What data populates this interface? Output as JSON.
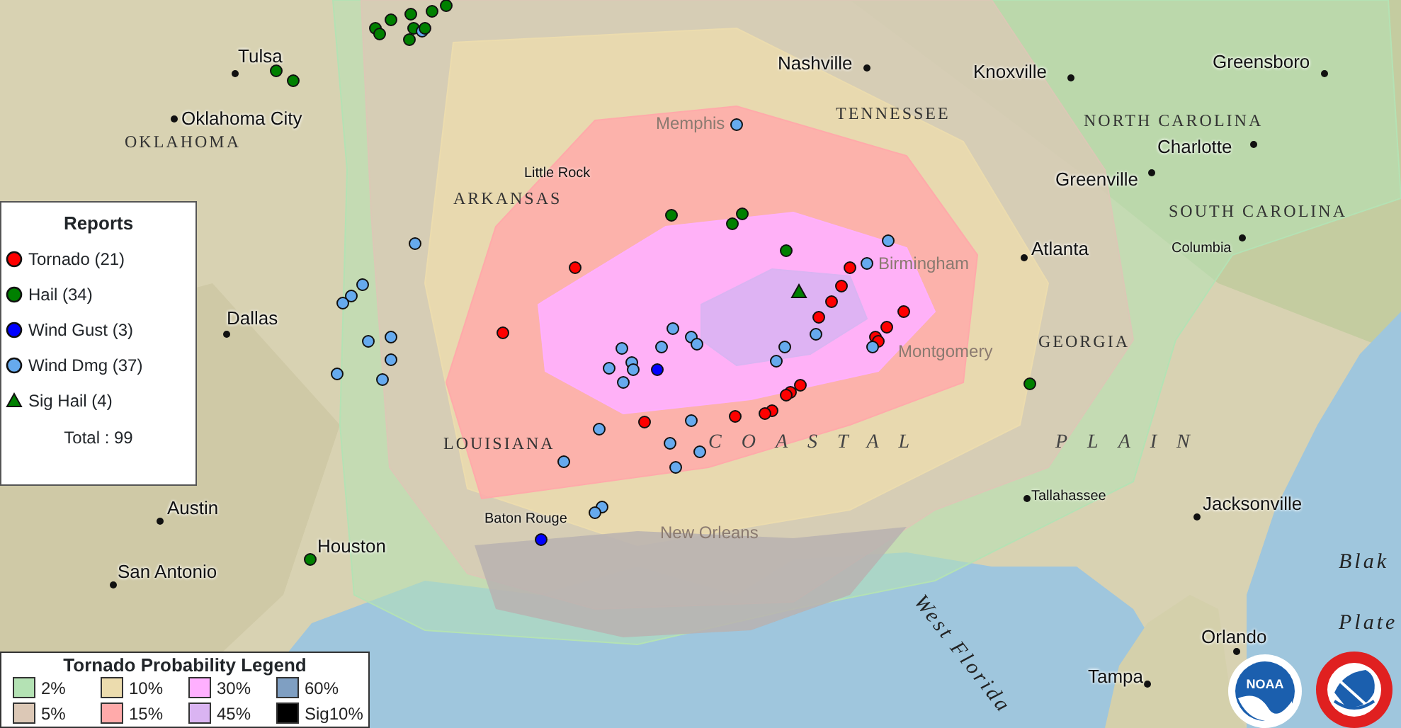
{
  "map": {
    "labels": [
      {
        "text": "Tulsa",
        "kind": "city"
      },
      {
        "text": "Oklahoma City",
        "kind": "city"
      },
      {
        "text": "OKLAHOMA",
        "kind": "state"
      },
      {
        "text": "Dallas",
        "kind": "city"
      },
      {
        "text": "Austin",
        "kind": "city"
      },
      {
        "text": "San Antonio",
        "kind": "city"
      },
      {
        "text": "Houston",
        "kind": "city"
      },
      {
        "text": "Baton Rouge",
        "kind": "minor"
      },
      {
        "text": "New Orleans",
        "kind": "faint"
      },
      {
        "text": "Memphis",
        "kind": "faint"
      },
      {
        "text": "Little Rock",
        "kind": "minor"
      },
      {
        "text": "ARKANSAS",
        "kind": "state"
      },
      {
        "text": "LOUISIANA",
        "kind": "state"
      },
      {
        "text": "Nashville",
        "kind": "city"
      },
      {
        "text": "TENNESSEE",
        "kind": "state"
      },
      {
        "text": "Knoxville",
        "kind": "city"
      },
      {
        "text": "Greensboro",
        "kind": "city"
      },
      {
        "text": "NORTH CAROLINA",
        "kind": "state"
      },
      {
        "text": "Charlotte",
        "kind": "city"
      },
      {
        "text": "Greenville",
        "kind": "city"
      },
      {
        "text": "SOUTH CAROLINA",
        "kind": "state"
      },
      {
        "text": "Columbia",
        "kind": "minor"
      },
      {
        "text": "Atlanta",
        "kind": "city"
      },
      {
        "text": "Birmingham",
        "kind": "faint"
      },
      {
        "text": "Montgomery",
        "kind": "faint"
      },
      {
        "text": "GEORGIA",
        "kind": "state"
      },
      {
        "text": "COASTAL",
        "kind": "region"
      },
      {
        "text": "PLAIN",
        "kind": "region"
      },
      {
        "text": "Tallahassee",
        "kind": "minor"
      },
      {
        "text": "Jacksonville",
        "kind": "city"
      },
      {
        "text": "Orlando",
        "kind": "city"
      },
      {
        "text": "Tampa",
        "kind": "city"
      },
      {
        "text": "Blak",
        "kind": "sea"
      },
      {
        "text": "Plate",
        "kind": "sea"
      },
      {
        "text": "West Florida",
        "kind": "sea"
      }
    ]
  },
  "reports_legend": {
    "title": "Reports",
    "items": [
      {
        "label": "Tornado (21)",
        "kind": "dot",
        "color": "#ff0000"
      },
      {
        "label": "Hail (34)",
        "kind": "dot",
        "color": "#008000"
      },
      {
        "label": "Wind Gust (3)",
        "kind": "dot",
        "color": "#0000ff"
      },
      {
        "label": "Wind Dmg (37)",
        "kind": "dot",
        "color": "#66aaee"
      },
      {
        "label": "Sig Hail (4)",
        "kind": "triangle",
        "color": "#008000"
      }
    ],
    "total": "Total : 99"
  },
  "tornado_legend": {
    "title": "Tornado Probability Legend",
    "items": [
      {
        "label": "2%",
        "color": "#b4e2b4"
      },
      {
        "label": "10%",
        "color": "#ecdcae"
      },
      {
        "label": "30%",
        "color": "#ffb0ff"
      },
      {
        "label": "60%",
        "color": "#7f9fc2"
      },
      {
        "label": "5%",
        "color": "#dcc8b6"
      },
      {
        "label": "15%",
        "color": "#ffaaaa"
      },
      {
        "label": "45%",
        "color": "#dab4f2"
      },
      {
        "label": "Sig10%",
        "color": "#000000"
      }
    ]
  },
  "logos": {
    "noaa": "NOAA"
  }
}
